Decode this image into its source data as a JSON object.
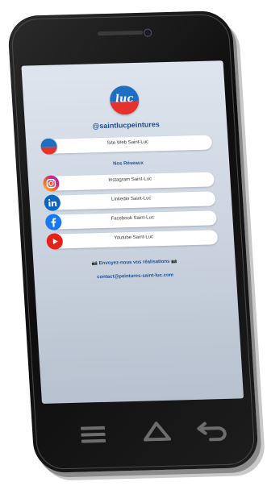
{
  "profile": {
    "logo_text": "luc",
    "handle": "@saintlucpeintures"
  },
  "links": {
    "website_label": "Site Web Saint-Luc",
    "networks_title": "Nos Réseaux",
    "instagram_label": "Instagram Saint-Luc",
    "linkedin_label": "Linkedin Saint-Luc",
    "facebook_label": "Facebook Saint-Luc",
    "youtube_label": "Youtube Saint-Luc"
  },
  "footer": {
    "send_text": "📷 Envoyez-nous vos réalisations 📷",
    "email": "contact@peintures-saint-luc.com"
  },
  "icons": {
    "instagram": "instagram-icon",
    "linkedin": "linkedin-icon",
    "facebook": "facebook-icon",
    "youtube": "youtube-icon",
    "menu": "menu-icon",
    "home": "home-icon",
    "back": "back-icon"
  },
  "colors": {
    "brand_blue": "#1e6fc4",
    "brand_red": "#e5322d",
    "text_blue": "#1f4f8f",
    "linkedin_blue": "#0a66c2",
    "facebook_blue": "#1877f2",
    "youtube_red": "#e62117"
  }
}
